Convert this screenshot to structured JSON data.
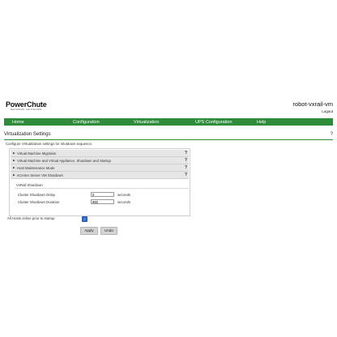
{
  "header": {
    "logo_text": "PowerChute",
    "logo_subtext": "NETWORK SHUTDOWN",
    "hostname": "robot-vxrail-vm",
    "logout": "Logout"
  },
  "nav": {
    "items": [
      {
        "label": "Home"
      },
      {
        "label": "Configuration"
      },
      {
        "label": "Virtualization"
      },
      {
        "label": "UPS Configuration"
      },
      {
        "label": "Help"
      }
    ],
    "color": "#2e8b3a"
  },
  "page": {
    "title": "Virtualization Settings",
    "help": "?",
    "intro": "Configure Virtualization settings for shutdown sequence."
  },
  "accordion": {
    "sections": [
      {
        "label": "Virtual Machine Migration",
        "help": "?"
      },
      {
        "label": "Virtual Machine and Virtual Appliance, Shutdown and Startup",
        "help": "?"
      },
      {
        "label": "Host Maintenance Mode",
        "help": "?"
      },
      {
        "label": "vCenter Server VM Shutdown",
        "help": "?"
      }
    ],
    "subsection": "VxRail Shutdown",
    "fields": [
      {
        "label": "Cluster Shutdown Delay",
        "value": "0",
        "unit": "seconds"
      },
      {
        "label": "Cluster Shutdown Duration",
        "value": "960",
        "unit": "seconds"
      }
    ]
  },
  "options": {
    "all_hosts_label": "All Hosts online prior to startup",
    "all_hosts_checked": true
  },
  "buttons": {
    "apply": "Apply",
    "undo": "Undo"
  }
}
